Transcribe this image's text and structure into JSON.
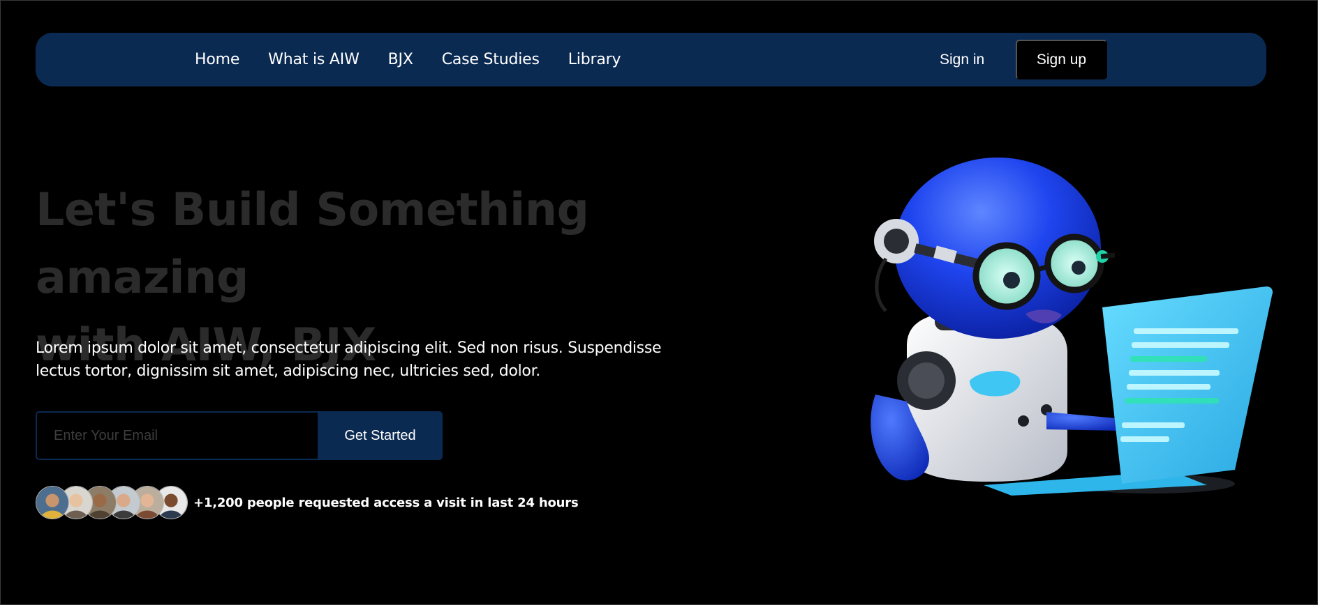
{
  "nav": {
    "links": [
      "Home",
      "What is AIW",
      "BJX",
      "Case Studies",
      "Library"
    ],
    "sign_in": "Sign in",
    "sign_up": "Sign up"
  },
  "hero": {
    "title_line1": "Let's Build Something amazing",
    "title_line2": "with AIW, BJX",
    "description_line1": "Lorem ipsum dolor sit amet, consectetur adipiscing elit. Sed non risus. Suspendisse",
    "description_line2": "lectus tortor, dignissim sit amet, adipiscing nec, ultricies sed, dolor.",
    "email_placeholder": "Enter Your Email",
    "cta_label": "Get Started",
    "social_proof": "+1,200 people requested access a visit in last 24 hours"
  },
  "avatars": [
    {
      "name": "avatar-1",
      "skin": "#c8956d",
      "bg": "#4d6e8f",
      "shirt": "#e0b23c"
    },
    {
      "name": "avatar-2",
      "skin": "#e6c2a1",
      "bg": "#d9d6cf",
      "shirt": "#6e5f52"
    },
    {
      "name": "avatar-3",
      "skin": "#9a6a47",
      "bg": "#8d7c66",
      "shirt": "#4f4233"
    },
    {
      "name": "avatar-4",
      "skin": "#d9a98a",
      "bg": "#c3cad0",
      "shirt": "#3b3b3b"
    },
    {
      "name": "avatar-5",
      "skin": "#e2b596",
      "bg": "#bcae9c",
      "shirt": "#7a4a33"
    },
    {
      "name": "avatar-6",
      "skin": "#7a4b2f",
      "bg": "#e9e9e9",
      "shirt": "#2c3b4f"
    }
  ],
  "colors": {
    "background": "#000000",
    "navbar": "#0b2a52",
    "title": "#2b2b2b",
    "robot_blue": "#1a3fe6",
    "laptop_cyan": "#3ec8f2"
  },
  "illustration": {
    "icon": "robot-with-laptop-illustration"
  }
}
